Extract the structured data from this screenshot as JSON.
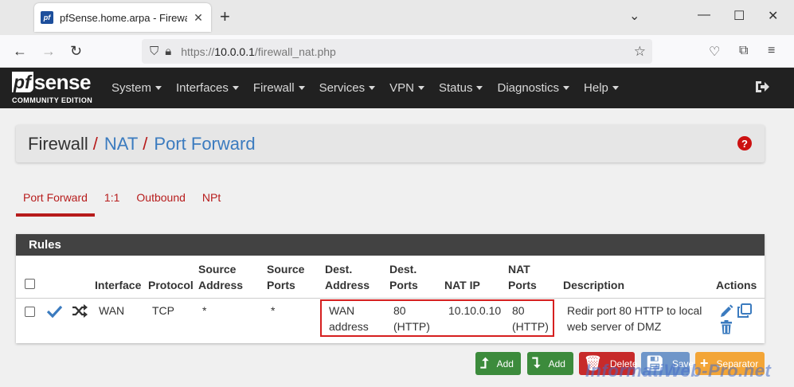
{
  "browser": {
    "tab_title": "pfSense.home.arpa - Firewall: N",
    "url_prefix": "https://",
    "url_host": "10.0.0.1",
    "url_path": "/firewall_nat.php"
  },
  "navbar": {
    "logo_pf": "pf",
    "logo_sense": "sense",
    "logo_sub": "COMMUNITY EDITION",
    "menu": [
      "System",
      "Interfaces",
      "Firewall",
      "Services",
      "VPN",
      "Status",
      "Diagnostics",
      "Help"
    ]
  },
  "breadcrumb": {
    "first": "Firewall",
    "sep": "/",
    "second": "NAT",
    "third": "Port Forward"
  },
  "tabs": [
    "Port Forward",
    "1:1",
    "Outbound",
    "NPt"
  ],
  "rules": {
    "title": "Rules",
    "columns": {
      "interface": "Interface",
      "protocol": "Protocol",
      "source_address_1": "Source",
      "source_address_2": "Address",
      "source_ports_1": "Source",
      "source_ports_2": "Ports",
      "dest_address_1": "Dest.",
      "dest_address_2": "Address",
      "dest_ports_1": "Dest.",
      "dest_ports_2": "Ports",
      "nat_ip": "NAT IP",
      "nat_ports_1": "NAT",
      "nat_ports_2": "Ports",
      "description": "Description",
      "actions": "Actions"
    },
    "row": {
      "interface": "WAN",
      "protocol": "TCP",
      "source_address": "*",
      "source_ports": "*",
      "dest_address_1": "WAN",
      "dest_address_2": "address",
      "dest_ports_1": "80",
      "dest_ports_2": "(HTTP)",
      "nat_ip": "10.10.0.10",
      "nat_ports_1": "80",
      "nat_ports_2": "(HTTP)",
      "description_1": "Redir port 80 HTTP to local",
      "description_2": "web server of DMZ"
    }
  },
  "buttons": {
    "add_top": "Add",
    "add_bottom": "Add",
    "delete": "Delete",
    "save": "Save",
    "separator": "Separator"
  },
  "watermark": "InformatiWeb-Pro.net",
  "colors": {
    "navbar": "#212121",
    "accent_red": "#b71c1c",
    "link_blue": "#3b7bbf",
    "success": "#3c8b3c",
    "danger": "#c72a2a",
    "warning": "#f3a537"
  }
}
